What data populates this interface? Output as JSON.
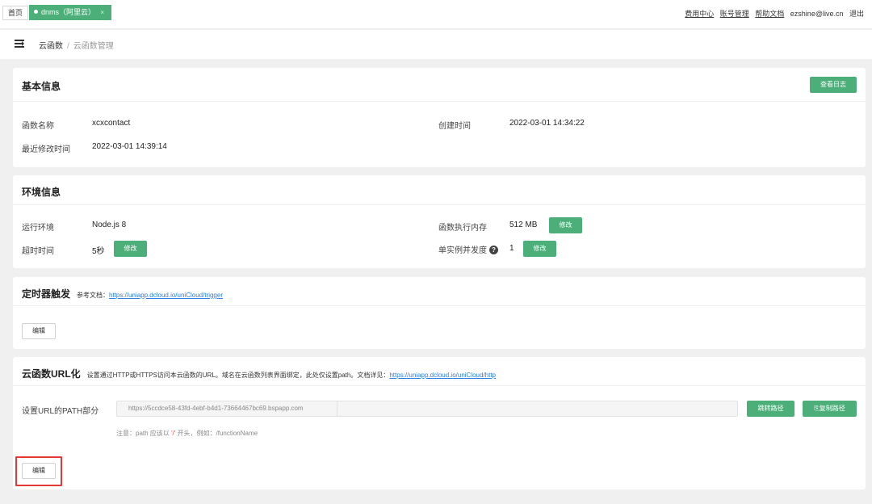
{
  "topbar": {
    "home_tab": "首页",
    "active_tab": "dnms（阿里云）",
    "close_glyph": "×",
    "links": [
      "费用中心",
      "账号管理",
      "帮助文档"
    ],
    "user_email": "ezshine@live.cn",
    "logout": "退出"
  },
  "breadcrumb": {
    "parent": "云函数",
    "separator": "/",
    "current": "云函数管理"
  },
  "basic": {
    "title": "基本信息",
    "view_log_button": "查看日志",
    "name_label": "函数名称",
    "name_value": "xcxcontact",
    "created_label": "创建时间",
    "created_value": "2022-03-01 14:34:22",
    "modified_label": "最近修改时间",
    "modified_value": "2022-03-01 14:39:14"
  },
  "env": {
    "title": "环境信息",
    "runtime_label": "运行环境",
    "runtime_value": "Node.js 8",
    "memory_label": "函数执行内存",
    "memory_value": "512 MB",
    "timeout_label": "超时时间",
    "timeout_value": "5秒",
    "concurrency_label": "单实例并发度",
    "concurrency_help": "?",
    "concurrency_value": "1",
    "modify_label": "修改"
  },
  "timer": {
    "title": "定时器触发",
    "note_prefix": "参考文档：",
    "note_link": "https://uniapp.dcloud.io/uniCloud/trigger",
    "edit_button": "编辑"
  },
  "url": {
    "title": "云函数URL化",
    "note_prefix": "设置通过HTTP或HTTPS访问本云函数的URL。域名在云函数列表界面绑定，此处仅设置path。文档详见：",
    "note_link": "https://uniapp.dcloud.io/uniCloud/http",
    "path_label": "设置URL的PATH部分",
    "path_value": "https://5ccdce58-43fd-4ebf-b4d1-73664467bc69.bspapp.com",
    "jump_button": "跳转路径",
    "copy_button": "复制路径",
    "hint_prefix": "注意：path 应该以 ",
    "hint_quote": "'/'",
    "hint_suffix": " 开头，例如：/functionName",
    "edit_button": "编辑"
  },
  "colors": {
    "accent_green": "#4caf7a",
    "link_blue": "#2b7de9",
    "highlight_red": "#e53935"
  }
}
